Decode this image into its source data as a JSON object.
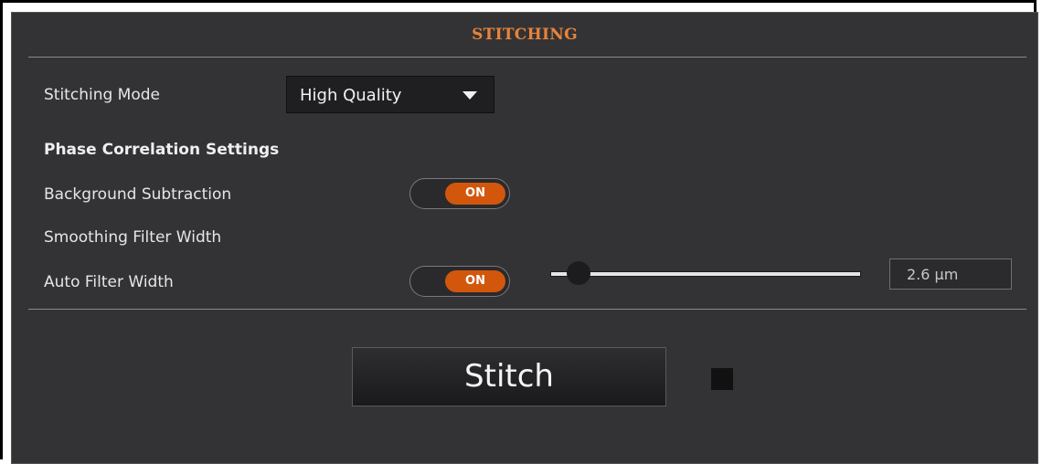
{
  "panel": {
    "title": "STITCHING",
    "accent_color": "#e8833a"
  },
  "stitching_mode": {
    "label": "Stitching Mode",
    "selected": "High Quality"
  },
  "phase_correlation": {
    "heading": "Phase Correlation Settings",
    "background_subtraction": {
      "label": "Background Subtraction",
      "state": "ON"
    },
    "smoothing_filter_width": {
      "label": "Smoothing Filter Width"
    },
    "auto_filter_width": {
      "label": "Auto Filter Width",
      "state": "ON"
    },
    "filter_width_value": "2.6 µm",
    "toggle_color": "#d2570d"
  },
  "actions": {
    "stitch_label": "Stitch",
    "stop_icon": "stop-icon"
  }
}
